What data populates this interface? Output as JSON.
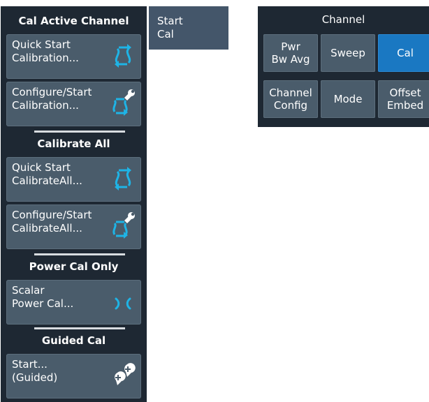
{
  "left_panel": {
    "sections": [
      {
        "header": "Cal Active Channel"
      },
      {
        "header": "Calibrate All"
      },
      {
        "header": "Power Cal Only"
      },
      {
        "header": "Guided Cal"
      }
    ],
    "buttons": [
      {
        "label": "Quick Start\nCalibration...",
        "icon": "quick-start-cal-icon"
      },
      {
        "label": "Configure/Start\nCalibration...",
        "icon": "configure-cal-wrench-icon"
      },
      {
        "label": "Quick Start\nCalibrateAll...",
        "icon": "quick-start-cal-icon"
      },
      {
        "label": "Configure/Start\nCalibrateAll...",
        "icon": "configure-cal-wrench-icon"
      },
      {
        "label": "Scalar\nPower Cal...",
        "icon": "power-cal-icon"
      },
      {
        "label": "Start...\n(Guided)",
        "icon": "guided-cal-icon"
      }
    ]
  },
  "start_cal_tab": {
    "label": "Start\nCal"
  },
  "channel_menu": {
    "title": "Channel",
    "buttons": [
      {
        "label": "Pwr\nBw Avg",
        "active": false
      },
      {
        "label": "Sweep",
        "active": false
      },
      {
        "label": "Cal",
        "active": true
      },
      {
        "label": "Channel\nConfig",
        "active": false
      },
      {
        "label": "Mode",
        "active": false
      },
      {
        "label": "Offset\nEmbed",
        "active": false
      }
    ]
  },
  "colors": {
    "panel_bg": "#1e2833",
    "button_bg": "#4a5c6b",
    "active_button": "#1a78c2",
    "icon_accent": "#1eb4e6",
    "divider": "#d8dce0"
  }
}
